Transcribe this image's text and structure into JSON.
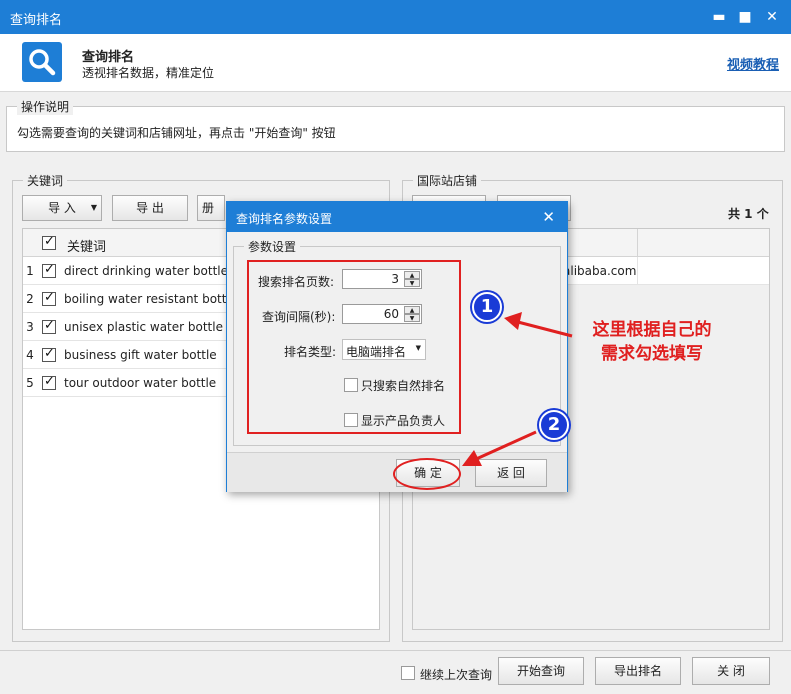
{
  "window": {
    "title": "查询排名",
    "controls": {
      "minimize": "▬",
      "maximize": "■",
      "close": "✕"
    }
  },
  "header": {
    "title": "查询排名",
    "subtitle": "透视排名数据，精准定位",
    "video_link": "视频教程",
    "icon": "search-icon",
    "accent_color": "#1e7ed6"
  },
  "instructions": {
    "legend": "操作说明",
    "text": "勾选需要查询的关键词和店铺网址，再点击 \"开始查询\" 按钮"
  },
  "keywords": {
    "legend": "关键词",
    "import_label": "导  入",
    "export_label": "导  出",
    "delete_label_partial": "册",
    "column_header": "关键词",
    "rows": [
      {
        "num": "1",
        "text": "direct drinking water bottle"
      },
      {
        "num": "2",
        "text": "boiling water resistant bottle"
      },
      {
        "num": "3",
        "text": "unisex plastic water bottle"
      },
      {
        "num": "4",
        "text": "business gift water bottle"
      },
      {
        "num": "5",
        "text": "tour outdoor water bottle"
      }
    ]
  },
  "stores": {
    "legend": "国际站店铺",
    "count": "共 1 个",
    "row_url_partial": "alibaba.com"
  },
  "dialog": {
    "title": "查询排名参数设置",
    "close": "✕",
    "group_legend": "参数设置",
    "pages_label": "搜索排名页数:",
    "pages_value": "3",
    "interval_label": "查询间隔(秒):",
    "interval_value": "60",
    "type_label": "排名类型:",
    "type_value": "电脑端排名",
    "organic_only": "只搜索自然排名",
    "show_owner": "显示产品负责人",
    "ok_label": "确  定",
    "back_label": "返  回"
  },
  "annotations": {
    "badge1": "1",
    "badge2": "2",
    "note_line1": "这里根据自己的",
    "note_line2": "需求勾选填写",
    "color": "#e02020"
  },
  "footer": {
    "continue_label": "继续上次查询",
    "start_label": "开始查询",
    "export_label": "导出排名",
    "close_label": "关  闭"
  }
}
